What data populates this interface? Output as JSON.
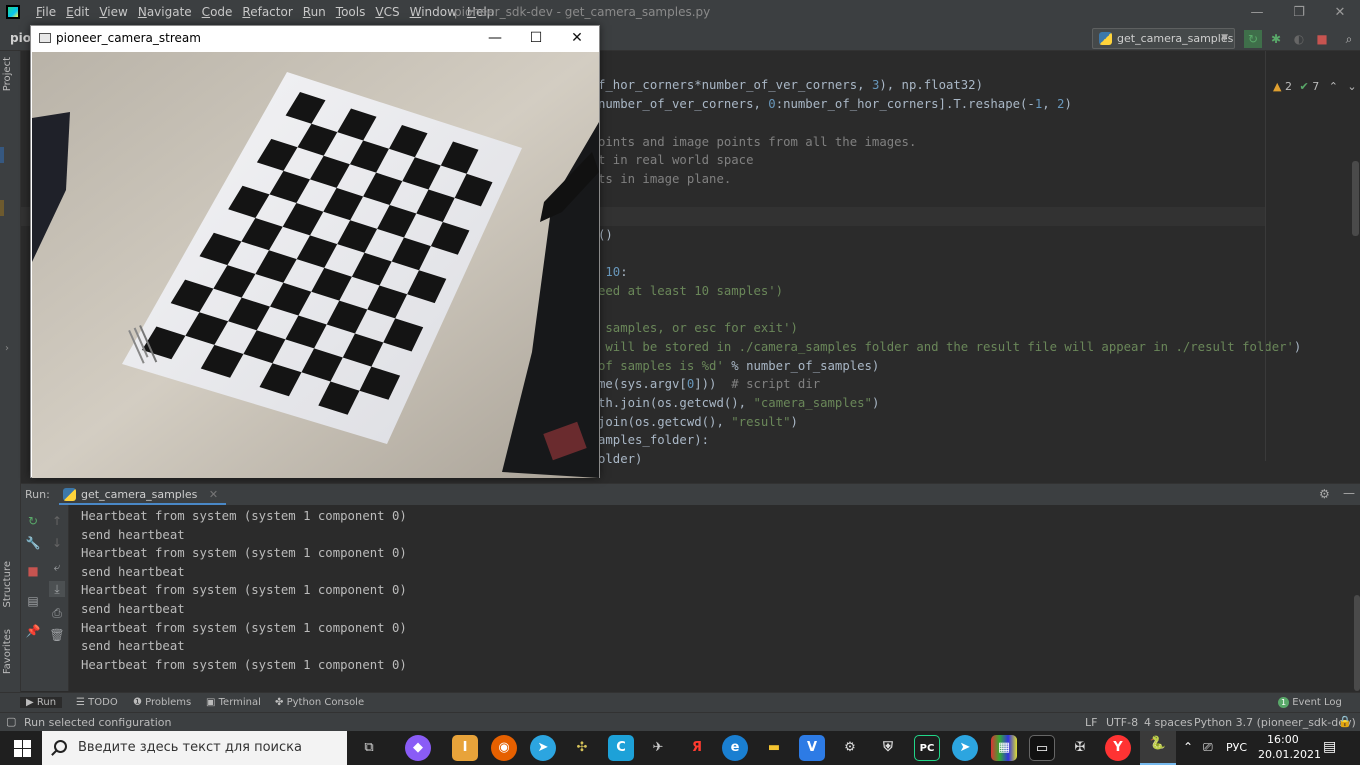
{
  "ide": {
    "menu": [
      "File",
      "Edit",
      "View",
      "Navigate",
      "Code",
      "Refactor",
      "Run",
      "Tools",
      "VCS",
      "Window",
      "Help"
    ],
    "window_title": "pioneer_sdk-dev - get_camera_samples.py",
    "project_crumb": "pior",
    "run_config": "get_camera_samples",
    "inspections": {
      "warnings": "2",
      "weak": "7"
    },
    "left_tabs": {
      "project": "Project",
      "structure": "Structure",
      "favorites": "Favorites"
    }
  },
  "editor": {
    "lines": [
      {
        "parts": [
          {
            "t": "f_hor_corners*number_of_ver_corners, ",
            "c": ""
          },
          {
            "t": "3",
            "c": "num"
          },
          {
            "t": "), np.float32)",
            "c": ""
          }
        ]
      },
      {
        "parts": [
          {
            "t": "number_of_ver_corners, ",
            "c": ""
          },
          {
            "t": "0",
            "c": "num"
          },
          {
            "t": ":number_of_hor_corners].T.reshape(-",
            "c": ""
          },
          {
            "t": "1",
            "c": "num"
          },
          {
            "t": ", ",
            "c": ""
          },
          {
            "t": "2",
            "c": "num"
          },
          {
            "t": ")",
            "c": ""
          }
        ]
      },
      {
        "parts": []
      },
      {
        "parts": [
          {
            "t": "oints and image points from all the images.",
            "c": "cmt"
          }
        ]
      },
      {
        "parts": [
          {
            "t": "t in real world space",
            "c": "cmt"
          }
        ]
      },
      {
        "parts": [
          {
            "t": "ts in image plane.",
            "c": "cmt"
          }
        ]
      },
      {
        "parts": []
      },
      {
        "parts": []
      },
      {
        "parts": [
          {
            "t": "()",
            "c": ""
          }
        ]
      },
      {
        "parts": []
      },
      {
        "parts": [
          {
            "t": " ",
            "c": ""
          },
          {
            "t": "10",
            "c": "num"
          },
          {
            "t": ":",
            "c": ""
          }
        ]
      },
      {
        "parts": [
          {
            "t": "eed at least 10 samples')",
            "c": "str"
          }
        ]
      },
      {
        "parts": []
      },
      {
        "parts": [
          {
            "t": " samples, or esc for exit')",
            "c": "str"
          }
        ]
      },
      {
        "parts": [
          {
            "t": " will be stored in ./camera_samples folder and the result file will appear in ./result folder'",
            "c": "str"
          },
          {
            "t": ")",
            "c": ""
          }
        ]
      },
      {
        "parts": [
          {
            "t": "of samples is %d' ",
            "c": "str"
          },
          {
            "t": "% number_of_samples)",
            "c": ""
          }
        ]
      },
      {
        "parts": [
          {
            "t": "me(sys.argv[",
            "c": ""
          },
          {
            "t": "0",
            "c": "num"
          },
          {
            "t": "]))  ",
            "c": ""
          },
          {
            "t": "# script dir",
            "c": "cmt"
          }
        ]
      },
      {
        "parts": [
          {
            "t": "th.join(os.getcwd(), ",
            "c": ""
          },
          {
            "t": "\"camera_samples\"",
            "c": "str"
          },
          {
            "t": ")",
            "c": ""
          }
        ]
      },
      {
        "parts": [
          {
            "t": "join(os.getcwd(), ",
            "c": ""
          },
          {
            "t": "\"result\"",
            "c": "str"
          },
          {
            "t": ")",
            "c": ""
          }
        ]
      },
      {
        "parts": [
          {
            "t": "amples_folder):",
            "c": ""
          }
        ]
      },
      {
        "parts": [
          {
            "t": "older)",
            "c": ""
          }
        ]
      }
    ]
  },
  "camera_window": {
    "title": "pioneer_camera_stream",
    "minimize": "—",
    "maximize": "☐",
    "close": "✕"
  },
  "run_panel": {
    "label": "Run:",
    "tab": "get_camera_samples",
    "output": [
      "Heartbeat from system (system 1 component 0)",
      "send heartbeat",
      "Heartbeat from system (system 1 component 0)",
      "send heartbeat",
      "Heartbeat from system (system 1 component 0)",
      "send heartbeat",
      "Heartbeat from system (system 1 component 0)",
      "send heartbeat",
      "Heartbeat from system (system 1 component 0)"
    ]
  },
  "tool_tabs": {
    "run": "Run",
    "todo": "TODO",
    "problems": "Problems",
    "terminal": "Terminal",
    "python_console": "Python Console",
    "event_log": "Event Log",
    "event_count": "1"
  },
  "status": {
    "message": "Run selected configuration",
    "line_sep": "LF",
    "encoding": "UTF-8",
    "indent": "4 spaces",
    "interpreter": "Python 3.7 (pioneer_sdk-dev)"
  },
  "taskbar": {
    "search_placeholder": "Введите здесь текст для поиска",
    "lang": "РУС",
    "time": "16:00",
    "date": "20.01.2021"
  },
  "colors": {
    "ide_bg": "#2b2b2b",
    "panel_bg": "#3c3f41",
    "accent": "#4a88c7"
  }
}
